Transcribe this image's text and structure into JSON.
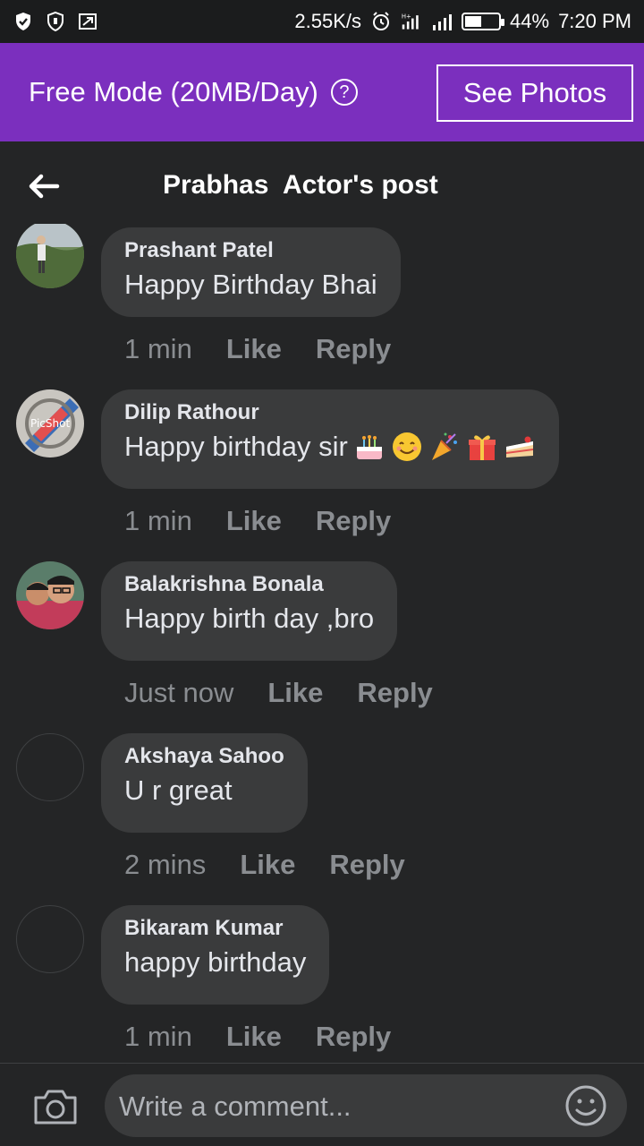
{
  "status_bar": {
    "speed": "2.55K/s",
    "battery": "44%",
    "time": "7:20 PM"
  },
  "banner": {
    "text": "Free Mode (20MB/Day)",
    "help": "?",
    "button_label": "See Photos",
    "color": "#7b2fbe"
  },
  "header": {
    "title": "Prabhas  Actor's post"
  },
  "comments": [
    {
      "author": "Prashant Patel",
      "text": "Happy Birthday Bhai",
      "time": "1 min",
      "like": "Like",
      "reply": "Reply"
    },
    {
      "author": "Dilip Rathour",
      "text": "Happy birthday sir",
      "emojis": [
        "birthday-cake",
        "smiling-face",
        "party-popper",
        "gift",
        "cake-slice"
      ],
      "time": "1 min",
      "like": "Like",
      "reply": "Reply"
    },
    {
      "author": "Balakrishna Bonala",
      "text": "Happy birth day ,bro",
      "time": "Just now",
      "like": "Like",
      "reply": "Reply"
    },
    {
      "author": "Akshaya Sahoo",
      "text": "U r great",
      "time": "2 mins",
      "like": "Like",
      "reply": "Reply"
    },
    {
      "author": "Bikaram Kumar",
      "text": "happy birthday",
      "time": "1 min",
      "like": "Like",
      "reply": "Reply"
    }
  ],
  "composer": {
    "placeholder": "Write a comment..."
  }
}
